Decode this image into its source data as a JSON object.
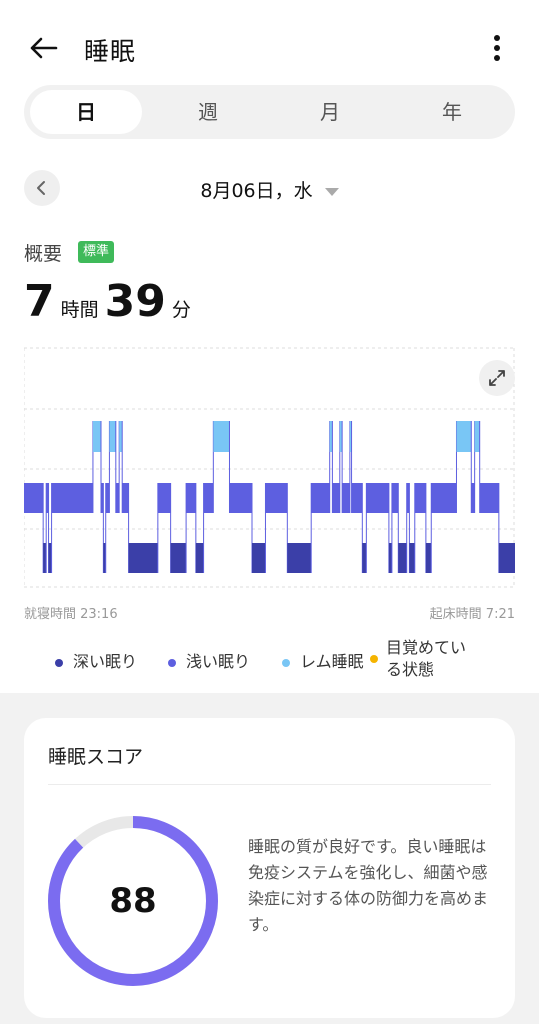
{
  "header": {
    "title": "睡眠"
  },
  "tabs": [
    {
      "label": "日",
      "active": true
    },
    {
      "label": "週",
      "active": false
    },
    {
      "label": "月",
      "active": false
    },
    {
      "label": "年",
      "active": false
    }
  ],
  "date": {
    "label": "8月06日，水"
  },
  "overview": {
    "label": "概要",
    "badge": "標準",
    "hours": "7",
    "hours_unit": "時間",
    "minutes": "39",
    "minutes_unit": "分"
  },
  "sleep_chart": {
    "bedtime_label": "就寝時間 23:16",
    "wake_label": "起床時間 7:21",
    "stages": [
      {
        "key": "deep",
        "color": "#3b3fa8"
      },
      {
        "key": "light",
        "color": "#5d5fe0"
      },
      {
        "key": "rem",
        "color": "#79c6f5"
      },
      {
        "key": "awake",
        "color": "#f5b400"
      }
    ],
    "segments": [
      [
        "light",
        0.0,
        5.7
      ],
      [
        "deep",
        5.7,
        6.6
      ],
      [
        "light",
        6.6,
        7.3
      ],
      [
        "deep",
        7.3,
        8.2
      ],
      [
        "light",
        8.2,
        20.5
      ],
      [
        "rem",
        20.5,
        22.9
      ],
      [
        "light",
        22.9,
        23.6
      ],
      [
        "deep",
        23.6,
        24.3
      ],
      [
        "light",
        24.3,
        25.4
      ],
      [
        "rem",
        25.4,
        27.3
      ],
      [
        "light",
        27.3,
        28.3
      ],
      [
        "rem",
        28.3,
        29.2
      ],
      [
        "light",
        29.2,
        31.1
      ],
      [
        "deep",
        31.1,
        39.8
      ],
      [
        "light",
        39.8,
        43.6
      ],
      [
        "deep",
        43.6,
        48.2
      ],
      [
        "light",
        48.2,
        51.1
      ],
      [
        "deep",
        51.1,
        53.4
      ],
      [
        "light",
        53.4,
        56.3
      ],
      [
        "rem",
        56.3,
        61.1
      ],
      [
        "light",
        61.1,
        67.8
      ],
      [
        "deep",
        67.8,
        71.8
      ],
      [
        "light",
        71.8,
        78.3
      ],
      [
        "deep",
        78.3,
        85.4
      ],
      [
        "light",
        85.4,
        90.9
      ],
      [
        "rem",
        90.9,
        91.7
      ],
      [
        "light",
        91.7,
        93.9
      ],
      [
        "rem",
        93.9,
        94.6
      ],
      [
        "light",
        94.6,
        96.9
      ],
      [
        "rem",
        96.9,
        97.4
      ],
      [
        "light",
        97.4,
        100.6
      ],
      [
        "deep",
        100.6,
        101.8
      ],
      [
        "light",
        101.8,
        108.5
      ],
      [
        "deep",
        108.5,
        109.4
      ],
      [
        "light",
        109.4,
        111.3
      ],
      [
        "deep",
        111.3,
        113.8
      ],
      [
        "light",
        113.8,
        114.6
      ],
      [
        "deep",
        114.6,
        116.2
      ],
      [
        "light",
        116.2,
        119.5
      ],
      [
        "deep",
        119.5,
        121.1
      ],
      [
        "light",
        121.1,
        128.6
      ],
      [
        "rem",
        128.6,
        133.0
      ],
      [
        "light",
        133.0,
        134.0
      ],
      [
        "rem",
        134.0,
        135.5
      ],
      [
        "light",
        135.5,
        141.2
      ],
      [
        "deep",
        141.2,
        146.0
      ]
    ],
    "total_minutes": 146.0
  },
  "legend": [
    {
      "label": "深い眠り",
      "color": "#3b3fa8"
    },
    {
      "label": "浅い眠り",
      "color": "#5d5fe0"
    },
    {
      "label": "レム睡眠",
      "color": "#79c6f5"
    },
    {
      "label": "目覚めている状態",
      "color": "#f5b400"
    }
  ],
  "score_card": {
    "title": "睡眠スコア",
    "score": "88",
    "score_fraction": 0.88,
    "ring_color": "#7b6cf0",
    "ring_track_color": "#e8e8e8",
    "description": "睡眠の質が良好です。良い睡眠は免疫システムを強化し、細菌や感染症に対する体の防御力を高めます。"
  }
}
